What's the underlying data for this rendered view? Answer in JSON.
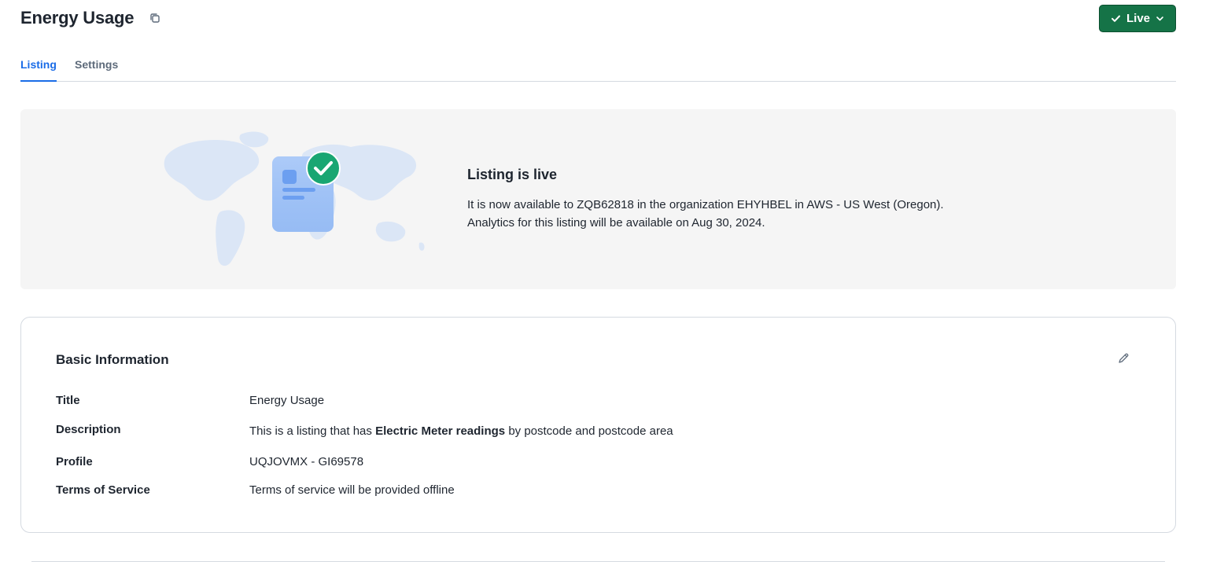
{
  "header": {
    "title": "Energy Usage",
    "copy_icon": "copy-icon",
    "status_button_label": "Live",
    "status_color": "#157347"
  },
  "tabs": [
    {
      "label": "Listing",
      "active": true
    },
    {
      "label": "Settings",
      "active": false
    }
  ],
  "banner": {
    "title": "Listing is live",
    "line1": "It is now available to ZQB62818 in the organization EHYHBEL in AWS - US West (Oregon).",
    "line2": "Analytics for this listing will be available on Aug 30, 2024.",
    "illustration": "world-map-listing-check-illustration"
  },
  "basic_info": {
    "title": "Basic Information",
    "edit_icon": "pencil-icon",
    "rows": [
      {
        "label": "Title",
        "value": "Energy Usage"
      },
      {
        "label": "Description",
        "value_pre": "This is a listing that has ",
        "value_bold": "Electric Meter readings",
        "value_post": " by postcode and postcode area"
      },
      {
        "label": "Profile",
        "value": "UQJOVMX - GI69578"
      },
      {
        "label": "Terms of Service",
        "value": "Terms of service will be provided offline"
      }
    ]
  },
  "colors": {
    "accent": "#1a6ce7",
    "live_green": "#157347",
    "check_green": "#19a672",
    "banner_bg": "#f5f5f5"
  }
}
